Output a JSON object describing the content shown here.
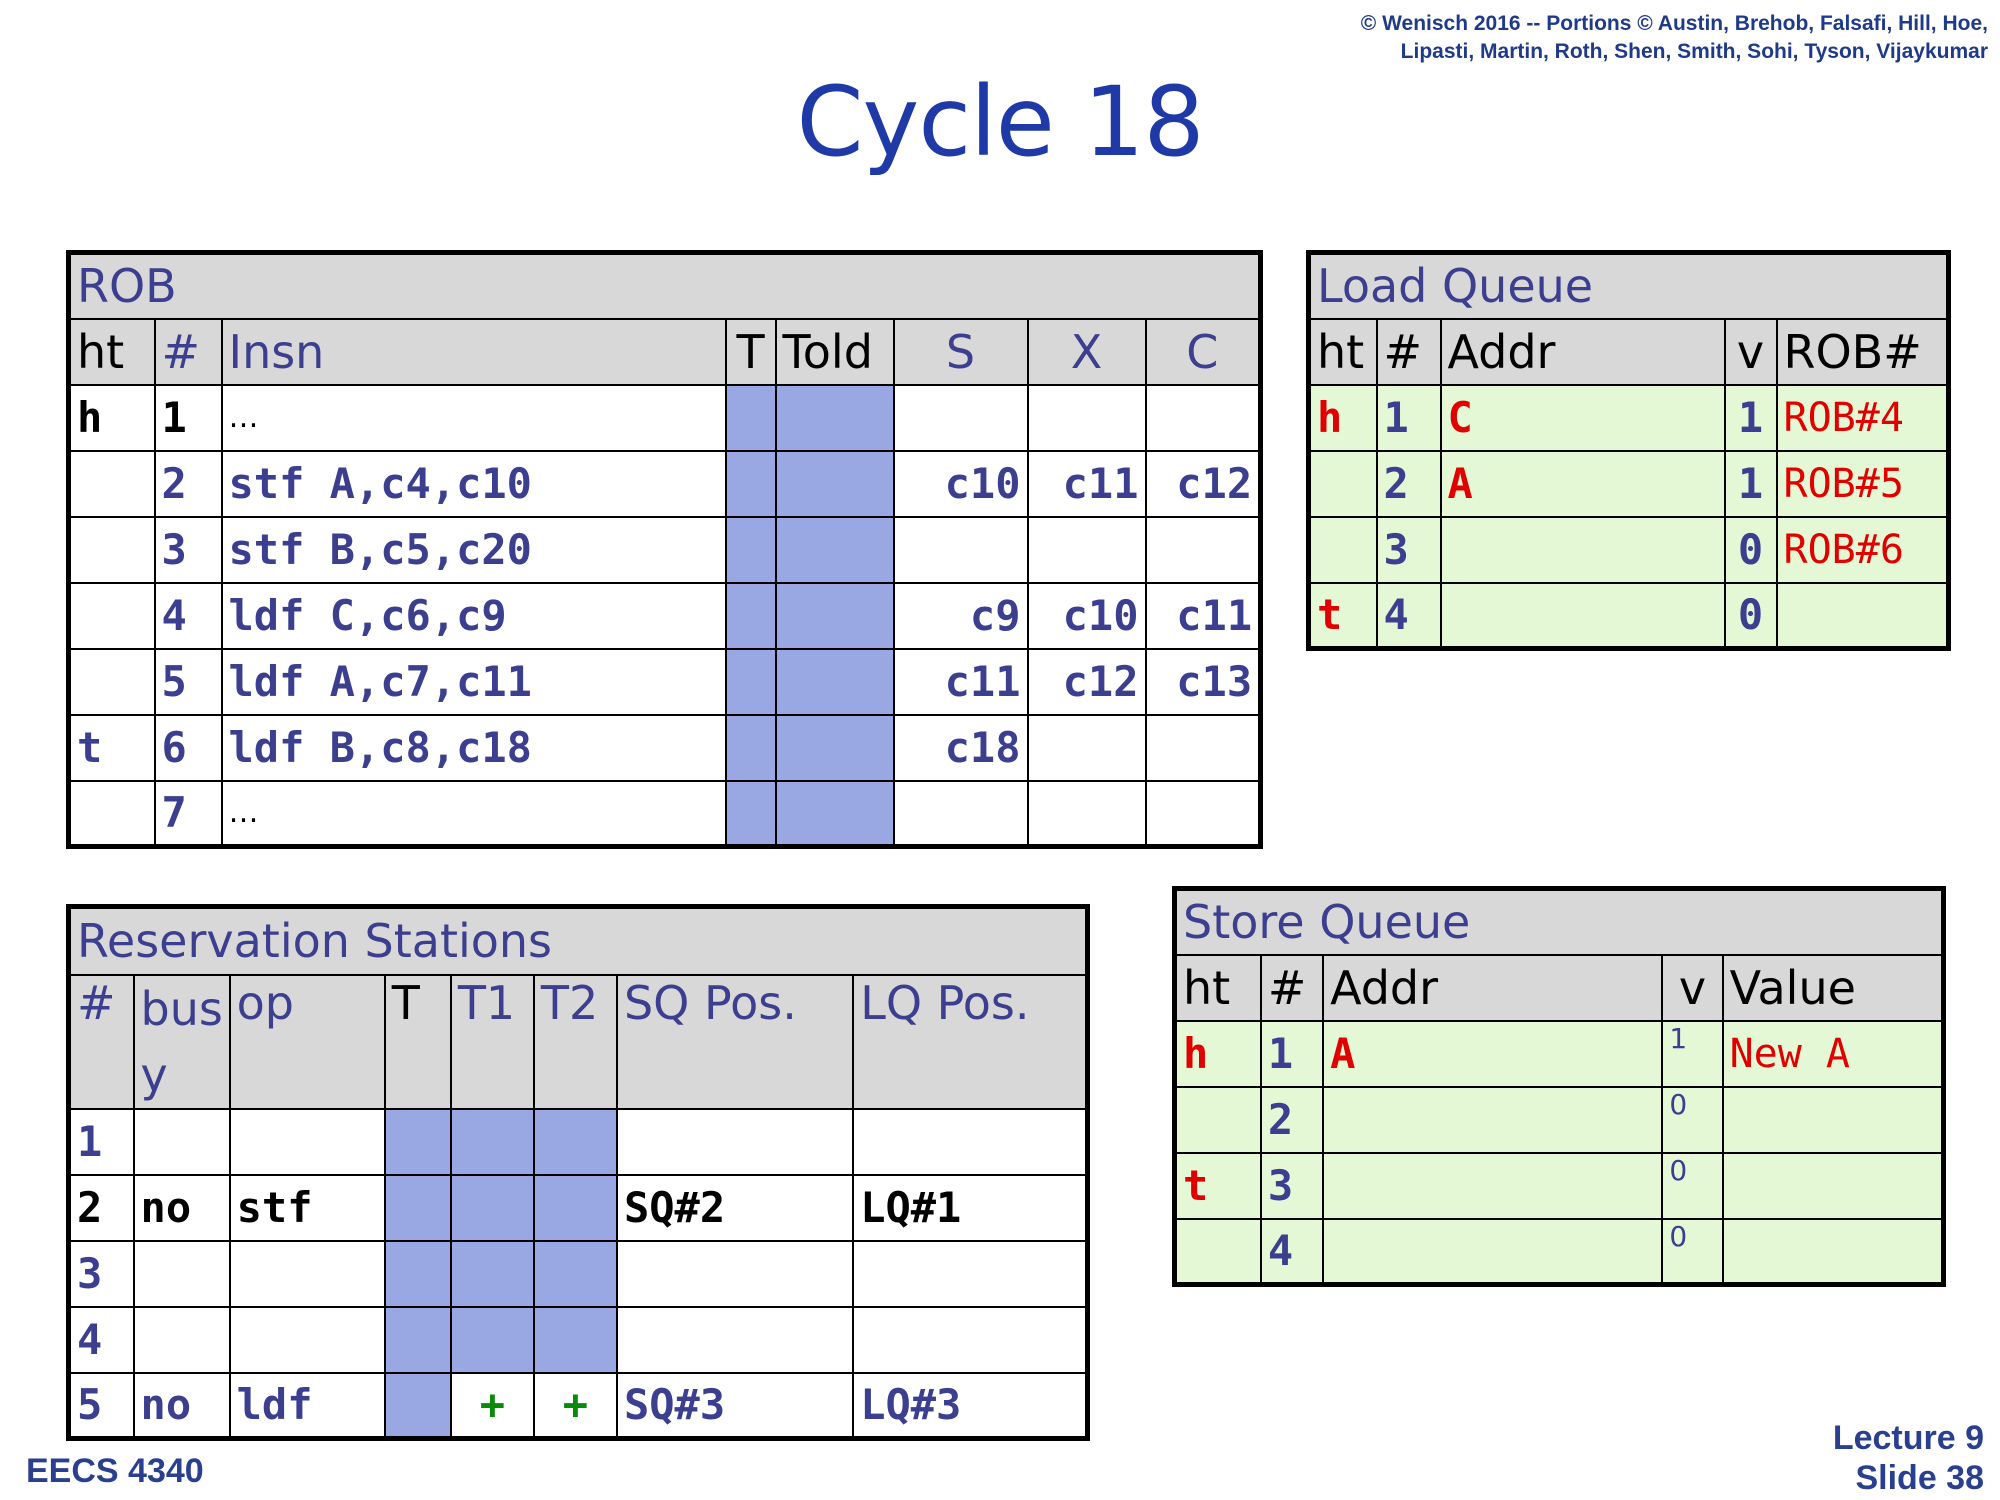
{
  "header": {
    "copyright_line1": "© Wenisch 2016 -- Portions © Austin, Brehob, Falsafi, Hill, Hoe,",
    "copyright_line2": "Lipasti, Martin, Roth, Shen, Smith, Sohi, Tyson, Vijaykumar",
    "title": "Cycle 18"
  },
  "footer": {
    "course": "EECS 4340",
    "lecture": "Lecture 9",
    "slide": "Slide 38"
  },
  "rob": {
    "caption": "ROB",
    "headers": [
      "ht",
      "#",
      "Insn",
      "T",
      "Told",
      "S",
      "X",
      "C"
    ],
    "rows": [
      {
        "ht": "h",
        "num": "1",
        "insn": "…",
        "s": "",
        "x": "",
        "c": ""
      },
      {
        "ht": "",
        "num": "2",
        "insn": "stf A,c4,c10",
        "s": "c10",
        "x": "c11",
        "c": "c12"
      },
      {
        "ht": "",
        "num": "3",
        "insn": "stf B,c5,c20",
        "s": "",
        "x": "",
        "c": ""
      },
      {
        "ht": "",
        "num": "4",
        "insn": "ldf C,c6,c9",
        "s": "c9",
        "x": "c10",
        "c": "c11"
      },
      {
        "ht": "",
        "num": "5",
        "insn": "ldf A,c7,c11",
        "s": "c11",
        "x": "c12",
        "c": "c13"
      },
      {
        "ht": "t",
        "num": "6",
        "insn": "ldf B,c8,c18",
        "s": "c18",
        "x": "",
        "c": ""
      },
      {
        "ht": "",
        "num": "7",
        "insn": "…",
        "s": "",
        "x": "",
        "c": ""
      }
    ]
  },
  "load_queue": {
    "caption": "Load Queue",
    "headers": [
      "ht",
      "#",
      "Addr",
      "v",
      "ROB#"
    ],
    "rows": [
      {
        "ht": "h",
        "num": "1",
        "addr": "C",
        "v": "1",
        "rob": "ROB#4"
      },
      {
        "ht": "",
        "num": "2",
        "addr": "A",
        "v": "1",
        "rob": "ROB#5"
      },
      {
        "ht": "",
        "num": "3",
        "addr": "",
        "v": "0",
        "rob": "ROB#6"
      },
      {
        "ht": "t",
        "num": "4",
        "addr": "",
        "v": "0",
        "rob": ""
      }
    ]
  },
  "reservation_stations": {
    "caption": "Reservation Stations",
    "headers": [
      "#",
      "bus",
      "y",
      "op",
      "T",
      "T1",
      "T2",
      "SQ Pos.",
      "LQ Pos."
    ],
    "rows": [
      {
        "num": "1",
        "busy": "",
        "op": "",
        "t1": "",
        "t2": "",
        "sq": "",
        "lq": ""
      },
      {
        "num": "2",
        "busy": "no",
        "op": "stf",
        "t1": "",
        "t2": "",
        "sq": "SQ#2",
        "lq": "LQ#1"
      },
      {
        "num": "3",
        "busy": "",
        "op": "",
        "t1": "",
        "t2": "",
        "sq": "",
        "lq": ""
      },
      {
        "num": "4",
        "busy": "",
        "op": "",
        "t1": "",
        "t2": "",
        "sq": "",
        "lq": ""
      },
      {
        "num": "5",
        "busy": "no",
        "op": "ldf",
        "t1": "+",
        "t2": "+",
        "sq": "SQ#3",
        "lq": "LQ#3"
      }
    ]
  },
  "store_queue": {
    "caption": "Store Queue",
    "headers": [
      "ht",
      "#",
      "Addr",
      "v",
      "Value"
    ],
    "rows": [
      {
        "ht": "h",
        "num": "1",
        "addr": "A",
        "v": "1",
        "value": "New A"
      },
      {
        "ht": "",
        "num": "2",
        "addr": "",
        "v": "0",
        "value": ""
      },
      {
        "ht": "t",
        "num": "3",
        "addr": "",
        "v": "0",
        "value": ""
      },
      {
        "ht": "",
        "num": "4",
        "addr": "",
        "v": "0",
        "value": ""
      }
    ]
  }
}
